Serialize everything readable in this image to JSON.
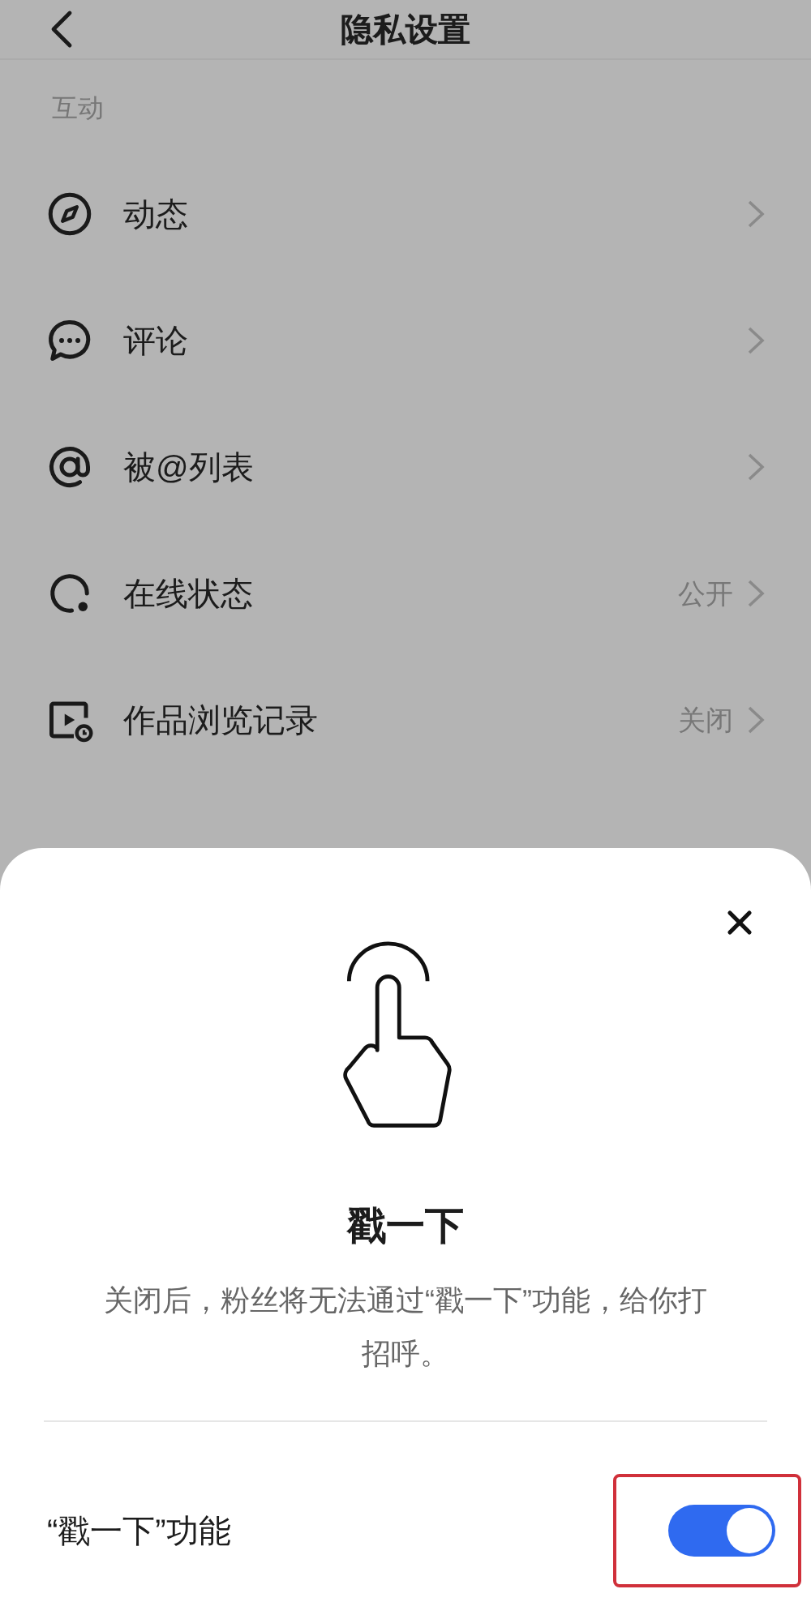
{
  "header": {
    "title": "隐私设置"
  },
  "section": {
    "title": "互动"
  },
  "rows": [
    {
      "label": "动态"
    },
    {
      "label": "评论"
    },
    {
      "label": "被@列表"
    },
    {
      "label": "在线状态",
      "value": "公开"
    },
    {
      "label": "作品浏览记录",
      "value": "关闭"
    }
  ],
  "sheet": {
    "title": "戳一下",
    "description": "关闭后，粉丝将无法通过“戳一下”功能，给你打招呼。",
    "setting": {
      "label": "“戳一下”功能",
      "on": true,
      "highlighted": true
    }
  }
}
